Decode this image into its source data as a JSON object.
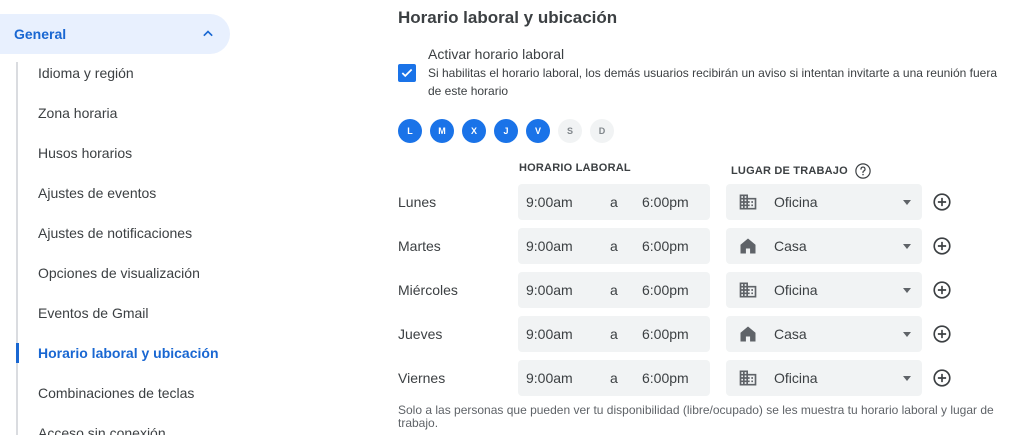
{
  "sidebar": {
    "section": "General",
    "items": [
      {
        "label": "Idioma y región"
      },
      {
        "label": "Zona horaria"
      },
      {
        "label": "Husos horarios"
      },
      {
        "label": "Ajustes de eventos"
      },
      {
        "label": "Ajustes de notificaciones"
      },
      {
        "label": "Opciones de visualización"
      },
      {
        "label": "Eventos de Gmail"
      },
      {
        "label": "Horario laboral y ubicación",
        "active": true
      },
      {
        "label": "Combinaciones de teclas"
      },
      {
        "label": "Acceso sin conexión"
      }
    ]
  },
  "main": {
    "title": "Horario laboral y ubicación",
    "enable_label": "Activar horario laboral",
    "enable_checked": true,
    "enable_desc": "Si habilitas el horario laboral, los demás usuarios recibirán un aviso si intentan invitarte a una reunión fuera de este horario",
    "days": [
      {
        "letter": "L",
        "on": true
      },
      {
        "letter": "M",
        "on": true
      },
      {
        "letter": "X",
        "on": true
      },
      {
        "letter": "J",
        "on": true
      },
      {
        "letter": "V",
        "on": true
      },
      {
        "letter": "S",
        "on": false
      },
      {
        "letter": "D",
        "on": false
      }
    ],
    "hours_header": "HORARIO LABORAL",
    "place_header": "LUGAR DE TRABAJO",
    "separator": "a",
    "rows": [
      {
        "day": "Lunes",
        "start": "9:00am",
        "end": "6:00pm",
        "place": "Oficina",
        "place_icon": "office-building-icon"
      },
      {
        "day": "Martes",
        "start": "9:00am",
        "end": "6:00pm",
        "place": "Casa",
        "place_icon": "home-icon"
      },
      {
        "day": "Miércoles",
        "start": "9:00am",
        "end": "6:00pm",
        "place": "Oficina",
        "place_icon": "office-building-icon"
      },
      {
        "day": "Jueves",
        "start": "9:00am",
        "end": "6:00pm",
        "place": "Casa",
        "place_icon": "home-icon"
      },
      {
        "day": "Viernes",
        "start": "9:00am",
        "end": "6:00pm",
        "place": "Oficina",
        "place_icon": "office-building-icon"
      }
    ],
    "footer": "Solo a las personas que pueden ver tu disponibilidad (libre/ocupado) se les muestra tu horario laboral y lugar de trabajo."
  },
  "colors": {
    "accent": "#1a73e8",
    "active_text": "#1967d2",
    "active_bg": "#e8f0fe",
    "field_bg": "#f1f3f4"
  }
}
